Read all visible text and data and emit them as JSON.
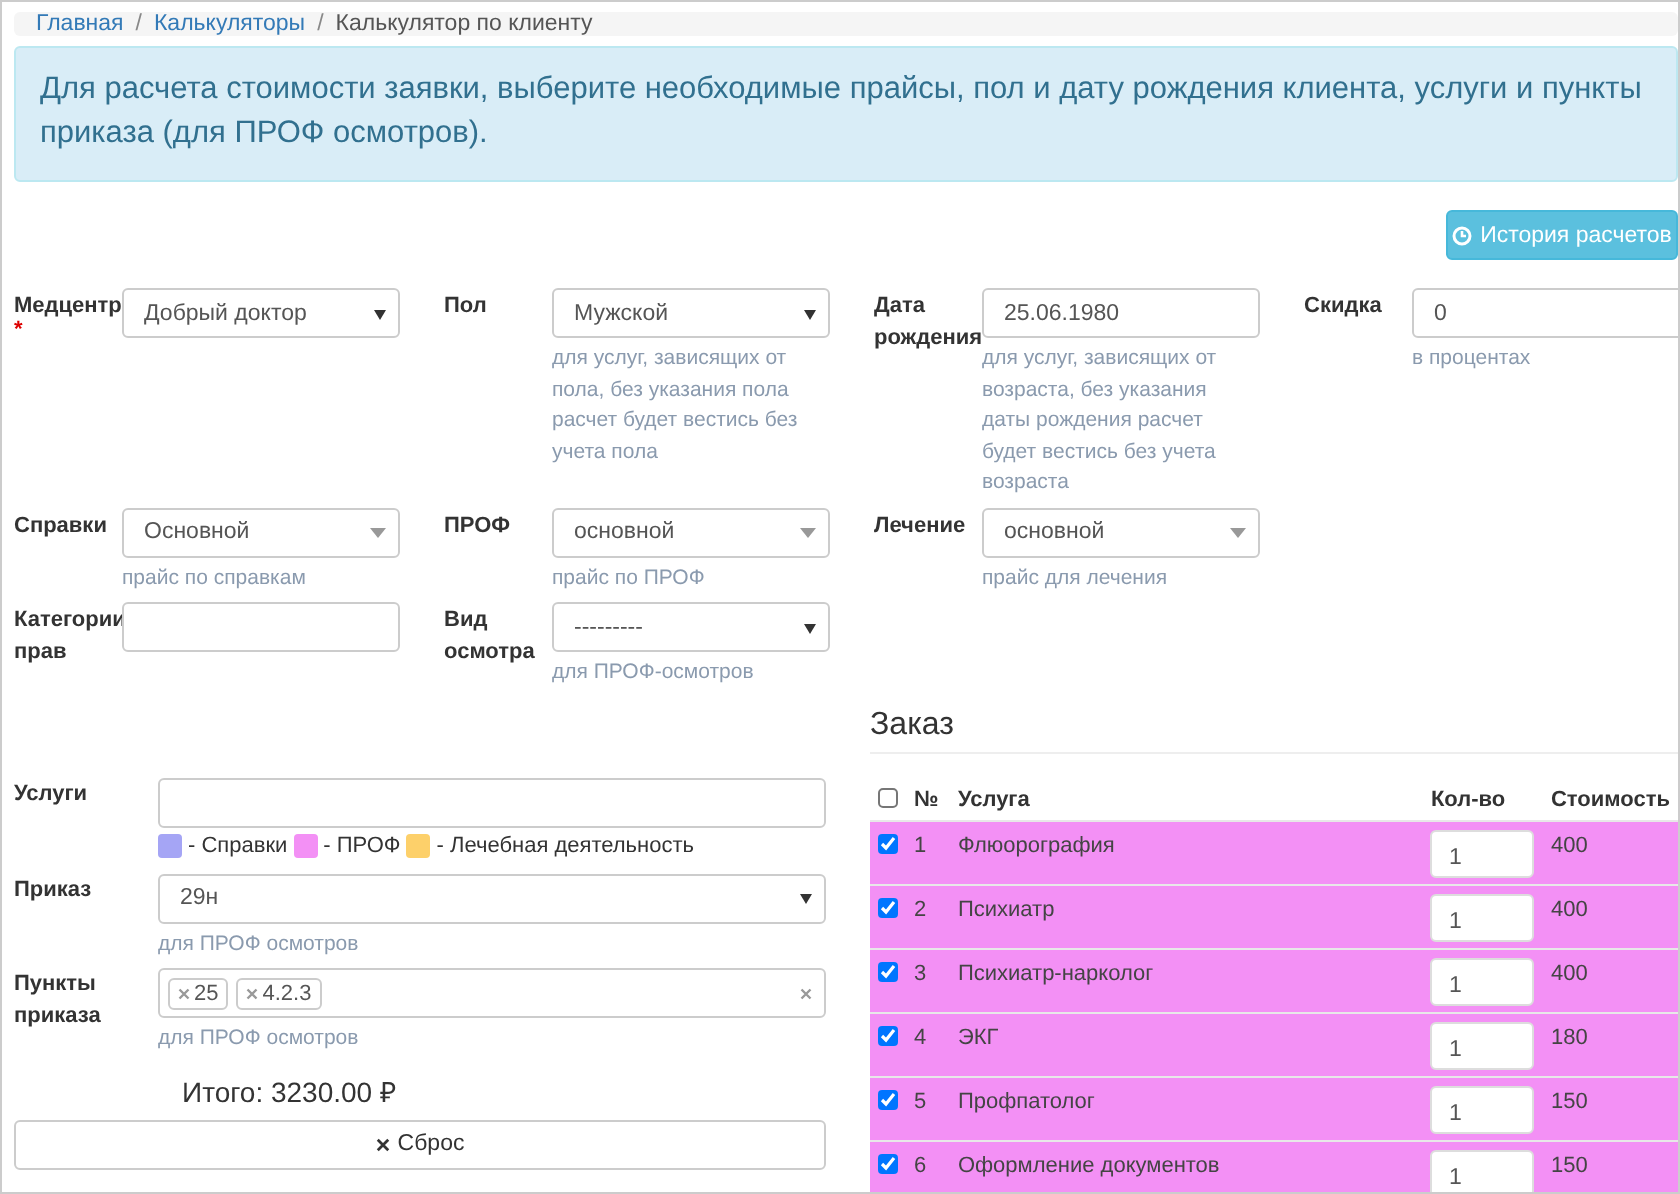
{
  "breadcrumbs": [
    {
      "label": "Главная",
      "kind": "link"
    },
    {
      "separator": "/",
      "label": "Калькуляторы",
      "kind": "link"
    },
    {
      "separator": "/",
      "label": "Калькулятор по клиенту",
      "kind": "current"
    }
  ],
  "alert": "Для расчета стоимости заявки, выберите необходимые прайсы, пол и дату рождения клиента, услуги и пункты приказа (для ПРОФ осмотров).",
  "history_button": "История расчетов",
  "form_rows": [
    [
      {
        "label": "Медцентр",
        "required_mark": "*",
        "kind": "select",
        "value": "Добрый доктор"
      },
      {
        "label": "Пол",
        "kind": "select",
        "value": "Мужской",
        "help": "для услуг, зависящих от пола, без указания пола расчет будет вестись без учета пола"
      },
      {
        "label": "Дата рождения",
        "kind": "input",
        "value": "25.06.1980",
        "help": "для услуг, зависящих от возраста, без указания даты рождения расчет будет вестись без учета возраста"
      },
      {
        "label": "Скидка",
        "kind": "input",
        "value": "0",
        "help": "в процентах"
      }
    ],
    [
      {
        "label": "Справки",
        "kind": "combo",
        "value": "Основной",
        "help": "прайс по справкам"
      },
      {
        "label": "ПРОФ",
        "kind": "combo",
        "value": "основной",
        "help": "прайс по ПРОФ"
      },
      {
        "label": "Лечение",
        "kind": "combo",
        "value": "основной",
        "help": "прайс для лечения"
      }
    ],
    [
      {
        "label": "Категории прав",
        "kind": "input"
      },
      {
        "label": "Вид осмотра",
        "kind": "select",
        "value": "---------",
        "help": "для ПРОФ-осмотров"
      }
    ]
  ],
  "services": {
    "label": "Услуги",
    "legend": [
      {
        "label": "- Справки",
        "color": "#a5a5f5"
      },
      {
        "label": "- ПРОФ",
        "color": "#f390f5"
      },
      {
        "label": "- Лечебная деятельность",
        "color": "#fdd06a"
      }
    ]
  },
  "order_select": {
    "label": "Приказ",
    "value": "29н",
    "help": "для ПРОФ осмотров"
  },
  "order_points": {
    "label": "Пункты приказа",
    "tags": [
      "25",
      "4.2.3"
    ],
    "help": "для ПРОФ осмотров"
  },
  "total": "Итого: 3230.00 ₽",
  "reset_button": "Сброс",
  "order": {
    "title": "Заказ",
    "all_checked": false,
    "columns": [
      "№",
      "Услуга",
      "Кол-во",
      "Стоимость"
    ],
    "rows": [
      {
        "checked": true,
        "num": "1",
        "name": "Флюорография",
        "qty": "1",
        "price": "400",
        "color": "#f390f5"
      },
      {
        "checked": true,
        "num": "2",
        "name": "Психиатр",
        "qty": "1",
        "price": "400",
        "color": "#f390f5"
      },
      {
        "checked": true,
        "num": "3",
        "name": "Психиатр-нарколог",
        "qty": "1",
        "price": "400",
        "color": "#f390f5"
      },
      {
        "checked": true,
        "num": "4",
        "name": "ЭКГ",
        "qty": "1",
        "price": "180",
        "color": "#f390f5"
      },
      {
        "checked": true,
        "num": "5",
        "name": "Профпатолог",
        "qty": "1",
        "price": "150",
        "color": "#f390f5"
      },
      {
        "checked": true,
        "num": "6",
        "name": "Оформление документов",
        "qty": "1",
        "price": "150",
        "color": "#f390f5"
      }
    ]
  }
}
